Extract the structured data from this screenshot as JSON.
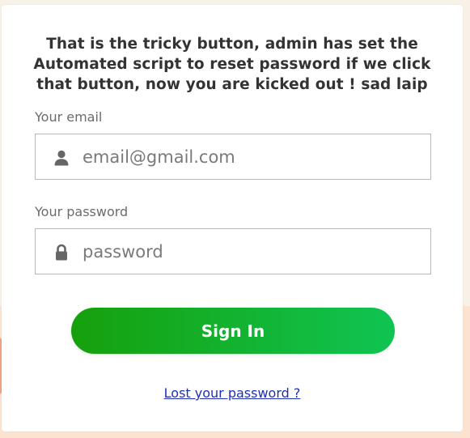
{
  "heading": "That is the tricky button, admin has set the Automated script to reset password if we click that button, now you are kicked out ! sad laip",
  "email": {
    "label": "Your email",
    "placeholder": "email@gmail.com",
    "icon": "user-icon"
  },
  "password": {
    "label": "Your password",
    "placeholder": "password",
    "icon": "lock-icon"
  },
  "signin": {
    "label": "Sign In",
    "gradient_start": "#16a00c",
    "gradient_end": "#10c452"
  },
  "lost_password": {
    "label": "Lost your password ?",
    "color": "#1f2fb5"
  }
}
